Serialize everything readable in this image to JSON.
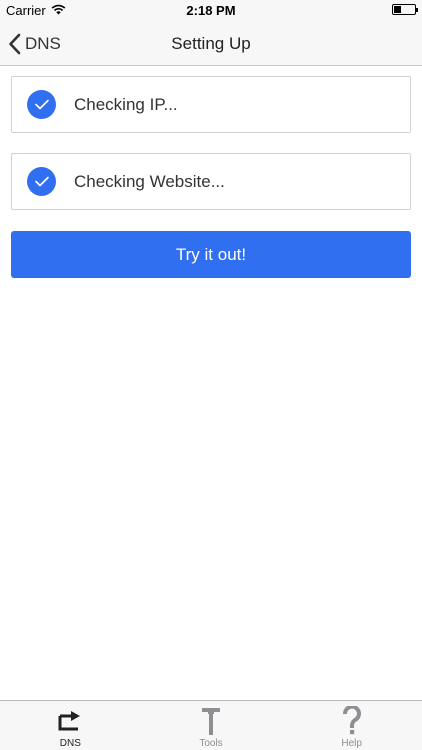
{
  "status_bar": {
    "carrier": "Carrier",
    "time": "2:18 PM",
    "battery_level": 0.35
  },
  "nav": {
    "back_label": "DNS",
    "title": "Setting Up"
  },
  "checks": [
    {
      "label": "Checking IP...",
      "icon": "checkmark-icon"
    },
    {
      "label": "Checking Website...",
      "icon": "checkmark-icon"
    }
  ],
  "primary_button": {
    "label": "Try it out!"
  },
  "tabs": [
    {
      "label": "DNS",
      "icon": "redirect-arrow-icon",
      "active": true
    },
    {
      "label": "Tools",
      "icon": "hammer-icon",
      "active": false
    },
    {
      "label": "Help",
      "icon": "question-mark-icon",
      "active": false
    }
  ],
  "colors": {
    "accent": "#2f6ff0",
    "bar_background": "#f7f7f7",
    "inactive_tab": "#8e8e93"
  }
}
